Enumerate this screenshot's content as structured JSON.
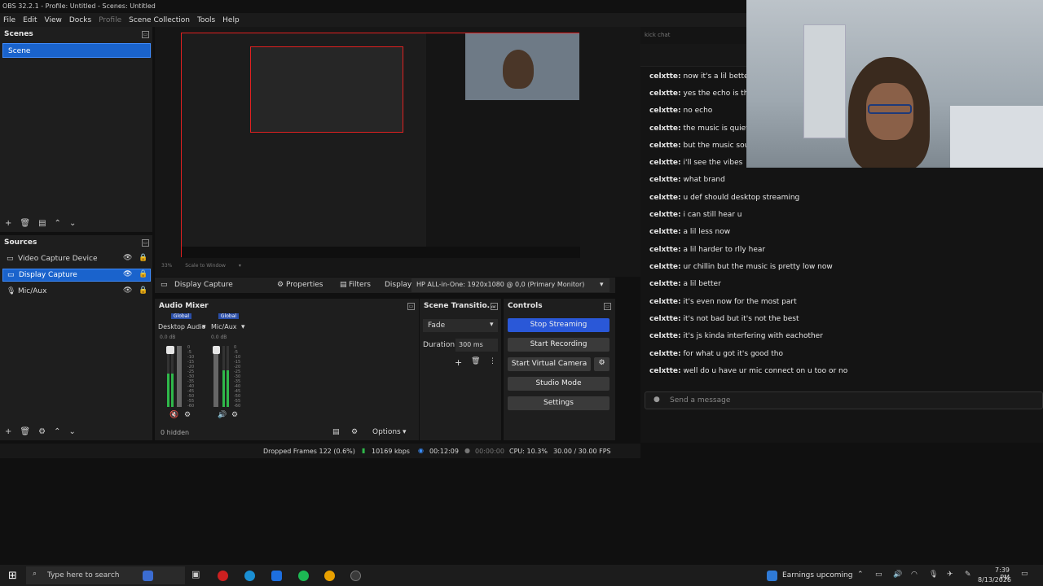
{
  "window": {
    "title": "OBS 32.2.1 - Profile: Untitled - Scenes: Untitled"
  },
  "menu": [
    "File",
    "Edit",
    "View",
    "Docks",
    "Profile",
    "Scene Collection",
    "Tools",
    "Help"
  ],
  "scenes": {
    "title": "Scenes",
    "items": [
      "Scene"
    ]
  },
  "sources": {
    "title": "Sources",
    "items": [
      "Video Capture Device",
      "Display Capture",
      "Mic/Aux"
    ]
  },
  "preview": {
    "zoom": "33%",
    "mode": "Scale to Window"
  },
  "source_toolbar": {
    "selected_source": "Display Capture",
    "properties_label": "Properties",
    "filters_label": "Filters",
    "display_label": "Display",
    "display_value": "HP ALL-in-One: 1920x1080 @ 0,0 (Primary Monitor)"
  },
  "audio_mixer": {
    "title": "Audio Mixer",
    "channels": [
      {
        "badge": "Global",
        "name": "Desktop Audio",
        "db": "0.0 dB",
        "level": 0.55,
        "muted": true
      },
      {
        "badge": "Global",
        "name": "Mic/Aux",
        "db": "0.0 dB",
        "level": 0.6,
        "muted": false
      }
    ],
    "scale": [
      "0",
      "-5",
      "-10",
      "-15",
      "-20",
      "-25",
      "-30",
      "-35",
      "-40",
      "-45",
      "-50",
      "-55",
      "-60"
    ],
    "hidden": "0 hidden",
    "options_label": "Options"
  },
  "transitions": {
    "title": "Scene Transitio...",
    "type": "Fade",
    "duration_label": "Duration",
    "duration_value": "300 ms"
  },
  "controls": {
    "title": "Controls",
    "stop_streaming": "Stop Streaming",
    "start_recording": "Start Recording",
    "start_virtual_camera": "Start Virtual Camera",
    "studio_mode": "Studio Mode",
    "settings": "Settings"
  },
  "status": {
    "dropped": "Dropped Frames 122 (0.6%)",
    "bitrate": "10169 kbps",
    "stream_time": "00:12:09",
    "rec_time": "00:00:00",
    "cpu": "CPU: 10.3%",
    "fps": "30.00 / 30.00 FPS"
  },
  "chat": {
    "title": "kick chat",
    "messages": [
      {
        "user": "celxtte:",
        "text": "now it's a lil better"
      },
      {
        "user": "celxtte:",
        "text": "yes the echo is the"
      },
      {
        "user": "celxtte:",
        "text": "no echo"
      },
      {
        "user": "celxtte:",
        "text": "the music is quiete"
      },
      {
        "user": "celxtte:",
        "text": "but the music soun"
      },
      {
        "user": "celxtte:",
        "text": "i'll see the vibes"
      },
      {
        "user": "celxtte:",
        "text": "what brand"
      },
      {
        "user": "celxtte:",
        "text": "u def should desktop streaming"
      },
      {
        "user": "celxtte:",
        "text": "i can still hear u"
      },
      {
        "user": "celxtte:",
        "text": "a lil less now"
      },
      {
        "user": "celxtte:",
        "text": "a lil harder to rlly hear"
      },
      {
        "user": "celxtte:",
        "text": "ur chillin but the music is pretty low now"
      },
      {
        "user": "celxtte:",
        "text": "a lil better"
      },
      {
        "user": "celxtte:",
        "text": "it's even now for the most part"
      },
      {
        "user": "celxtte:",
        "text": "it's not bad but it's not the best"
      },
      {
        "user": "celxtte:",
        "text": "it's js kinda interfering with eachother"
      },
      {
        "user": "celxtte:",
        "text": "for what u got it's good tho"
      },
      {
        "user": "celxtte:",
        "text": "well do u have ur mic connect on u too or no"
      }
    ],
    "placeholder": "Send a message"
  },
  "taskbar": {
    "search_placeholder": "Type here to search",
    "news": "Earnings upcoming",
    "time": "7:39 PM",
    "date": "8/13/2026"
  },
  "colors": {
    "accent": "#2a58d8",
    "selection": "#1a63cc",
    "meter_green": "#2fb84a"
  }
}
